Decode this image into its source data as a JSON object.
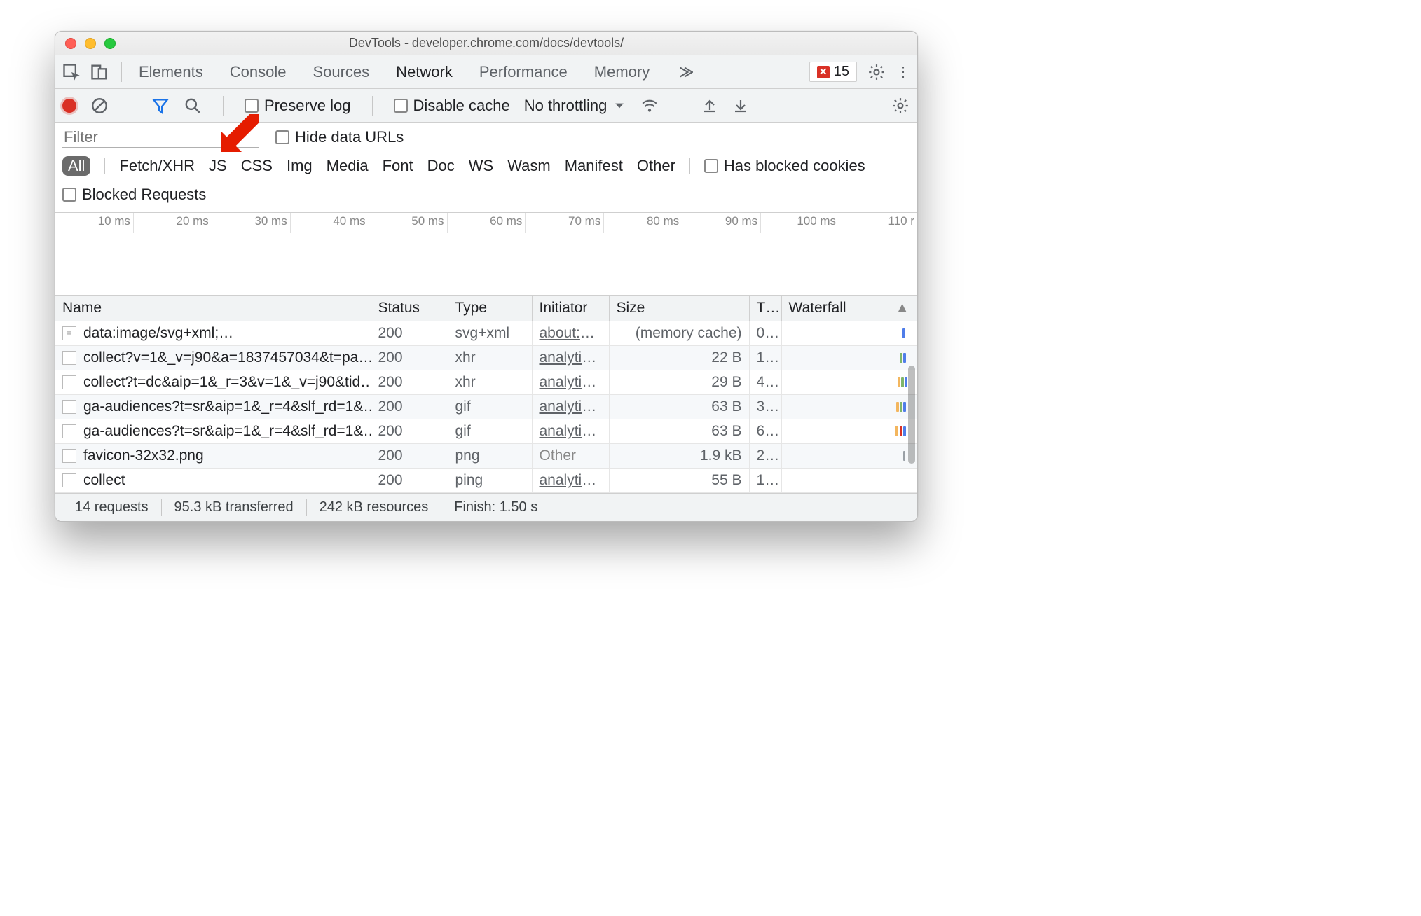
{
  "window": {
    "title": "DevTools - developer.chrome.com/docs/devtools/"
  },
  "tabs": {
    "items": [
      "Elements",
      "Console",
      "Sources",
      "Network",
      "Performance",
      "Memory"
    ],
    "active_index": 3,
    "errors_count": "15"
  },
  "network_toolbar": {
    "preserve_log": "Preserve log",
    "disable_cache": "Disable cache",
    "throttling": "No throttling"
  },
  "filter": {
    "placeholder": "Filter",
    "hide_data_urls": "Hide data URLs",
    "types": [
      "All",
      "Fetch/XHR",
      "JS",
      "CSS",
      "Img",
      "Media",
      "Font",
      "Doc",
      "WS",
      "Wasm",
      "Manifest",
      "Other"
    ],
    "active_type_index": 0,
    "has_blocked_cookies": "Has blocked cookies",
    "blocked_requests": "Blocked Requests"
  },
  "overview": {
    "ticks": [
      "10 ms",
      "20 ms",
      "30 ms",
      "40 ms",
      "50 ms",
      "60 ms",
      "70 ms",
      "80 ms",
      "90 ms",
      "100 ms",
      "110 r"
    ]
  },
  "table": {
    "headers": {
      "name": "Name",
      "status": "Status",
      "type": "Type",
      "initiator": "Initiator",
      "size": "Size",
      "time": "T…",
      "waterfall": "Waterfall"
    },
    "rows": [
      {
        "icon": "doc",
        "name": "data:image/svg+xml;…",
        "status": "200",
        "type": "svg+xml",
        "initiator": "about:cl…",
        "initiator_link": true,
        "size": "(memory cache)",
        "time": "0…",
        "wf": [
          {
            "l": 94,
            "w": 4,
            "c": "#4f7de9"
          }
        ]
      },
      {
        "icon": "box",
        "name": "collect?v=1&_v=j90&a=1837457034&t=pa…",
        "status": "200",
        "type": "xhr",
        "initiator": "analytic…",
        "initiator_link": true,
        "size": "22 B",
        "time": "1…",
        "wf": [
          {
            "l": 92,
            "w": 4,
            "c": "#7fb56b"
          },
          {
            "l": 95,
            "w": 4,
            "c": "#4f7de9"
          }
        ]
      },
      {
        "icon": "box",
        "name": "collect?t=dc&aip=1&_r=3&v=1&_v=j90&tid…",
        "status": "200",
        "type": "xhr",
        "initiator": "analytic…",
        "initiator_link": true,
        "size": "29 B",
        "time": "4…",
        "wf": [
          {
            "l": 90,
            "w": 4,
            "c": "#f3b65e"
          },
          {
            "l": 93,
            "w": 4,
            "c": "#7fb56b"
          },
          {
            "l": 96,
            "w": 4,
            "c": "#4f7de9"
          }
        ]
      },
      {
        "icon": "box",
        "name": "ga-audiences?t=sr&aip=1&_r=4&slf_rd=1&…",
        "status": "200",
        "type": "gif",
        "initiator": "analytic…",
        "initiator_link": true,
        "size": "63 B",
        "time": "3…",
        "wf": [
          {
            "l": 89,
            "w": 4,
            "c": "#f3b65e"
          },
          {
            "l": 92,
            "w": 4,
            "c": "#7fb56b"
          },
          {
            "l": 95,
            "w": 4,
            "c": "#4f7de9"
          }
        ]
      },
      {
        "icon": "box",
        "name": "ga-audiences?t=sr&aip=1&_r=4&slf_rd=1&…",
        "status": "200",
        "type": "gif",
        "initiator": "analytic…",
        "initiator_link": true,
        "size": "63 B",
        "time": "6…",
        "wf": [
          {
            "l": 88,
            "w": 5,
            "c": "#f3b65e"
          },
          {
            "l": 92,
            "w": 4,
            "c": "#d93025"
          },
          {
            "l": 95,
            "w": 4,
            "c": "#4f7de9"
          }
        ]
      },
      {
        "icon": "box",
        "name": "favicon-32x32.png",
        "status": "200",
        "type": "png",
        "initiator": "Other",
        "initiator_link": false,
        "size": "1.9 kB",
        "time": "2…",
        "wf": [
          {
            "l": 95,
            "w": 3,
            "c": "#9aa0a6"
          }
        ]
      },
      {
        "icon": "box",
        "name": "collect",
        "status": "200",
        "type": "ping",
        "initiator": "analytic…",
        "initiator_link": true,
        "size": "55 B",
        "time": "1…",
        "wf": []
      }
    ]
  },
  "statusbar": {
    "requests": "14 requests",
    "transferred": "95.3 kB transferred",
    "resources": "242 kB resources",
    "finish": "Finish: 1.50 s"
  }
}
